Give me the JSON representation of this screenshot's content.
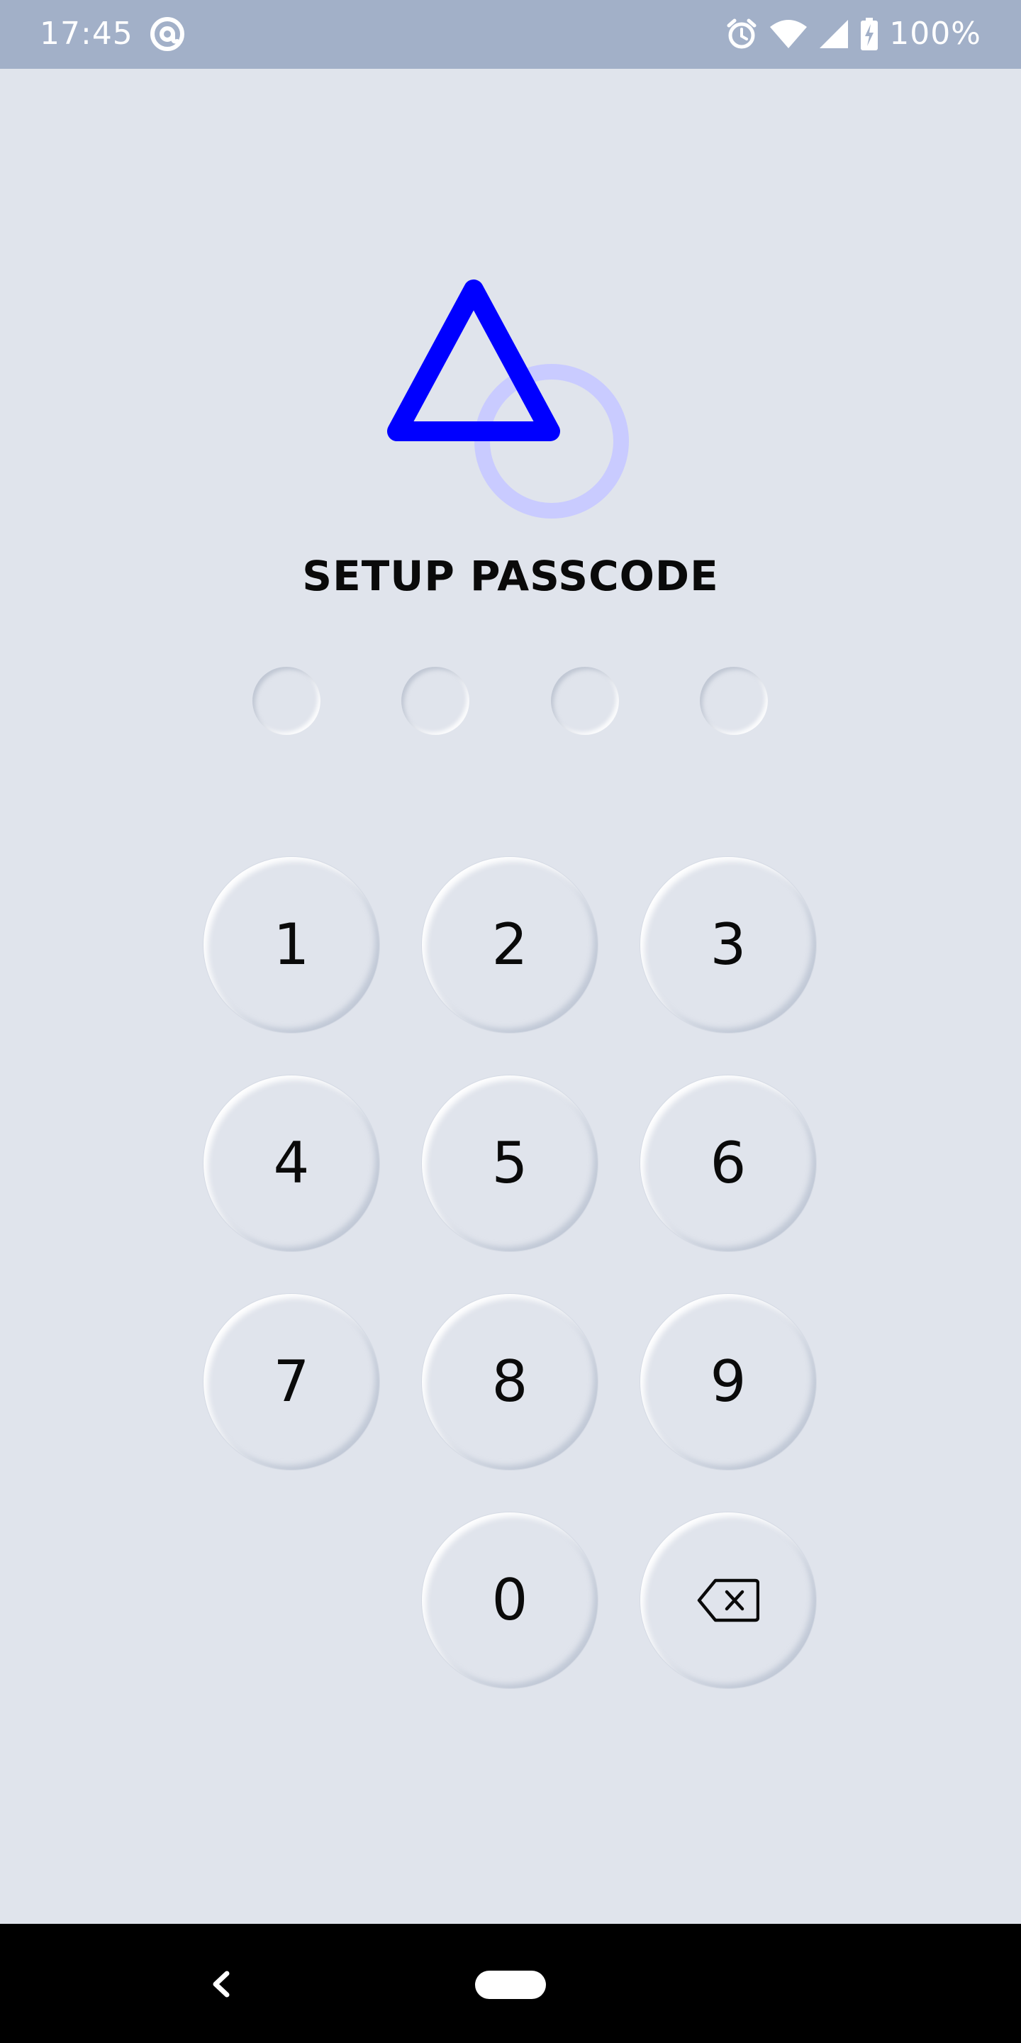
{
  "status_bar": {
    "time": "17:45",
    "battery": "100%",
    "icons": [
      "at-sign-icon",
      "alarm-icon",
      "wifi-icon",
      "signal-icon",
      "battery-charging-icon"
    ]
  },
  "logo": {
    "icons": [
      "triangle-icon",
      "circle-icon"
    ],
    "colors": {
      "triangle": "#0000ff",
      "circle": "#c9cbff"
    }
  },
  "title": "SETUP PASSCODE",
  "pin": {
    "length": 4,
    "filled": 0
  },
  "keypad": {
    "keys": [
      "1",
      "2",
      "3",
      "4",
      "5",
      "6",
      "7",
      "8",
      "9",
      "0"
    ],
    "backspace_icon": "backspace-icon"
  },
  "nav_bar": {
    "icons": [
      "back-icon",
      "home-pill-icon"
    ]
  },
  "colors": {
    "background": "#e0e4ec",
    "status_bar": "#a2b0c8",
    "accent": "#0000ff",
    "text": "#0a0a0a"
  }
}
